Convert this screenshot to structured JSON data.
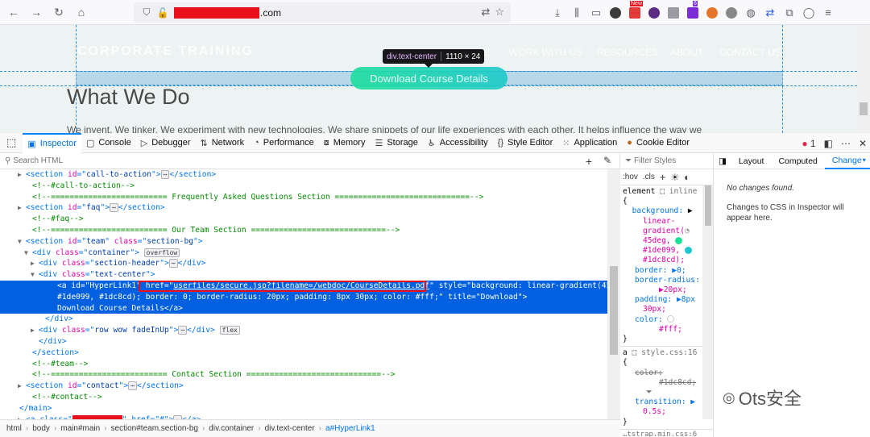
{
  "browser": {
    "url_domain": ".com",
    "toolbar_icons": [
      "back-icon",
      "forward-icon",
      "reload-icon",
      "home-icon"
    ],
    "new_badge": "New",
    "ext_badge_count": "6"
  },
  "page": {
    "brand": "CORPORATE TRAINING",
    "nav": [
      "E",
      "WORK WITH US",
      "RESOURCES",
      "ABOUT",
      "CONTACT US"
    ],
    "download_label": "Download Course Details",
    "heading": "What We Do",
    "paragraph": "We invent. We tinker. We experiment with new technologies. We share snippets of our life experiences with each other. It helps influence the way we",
    "tooltip_tag": "div.text-center",
    "tooltip_size": "1110 × 24"
  },
  "devtools": {
    "tabs": [
      {
        "label": "Inspector",
        "icon": "inspector-icon"
      },
      {
        "label": "Console",
        "icon": "console-icon"
      },
      {
        "label": "Debugger",
        "icon": "debugger-icon"
      },
      {
        "label": "Network",
        "icon": "network-icon"
      },
      {
        "label": "Performance",
        "icon": "performance-icon"
      },
      {
        "label": "Memory",
        "icon": "memory-icon"
      },
      {
        "label": "Storage",
        "icon": "storage-icon"
      },
      {
        "label": "Accessibility",
        "icon": "accessibility-icon"
      },
      {
        "label": "Style Editor",
        "icon": "style-editor-icon"
      },
      {
        "label": "Application",
        "icon": "application-icon"
      },
      {
        "label": "Cookie Editor",
        "icon": "cookie-icon"
      }
    ],
    "error_count": "1",
    "search_placeholder": "Search HTML",
    "markup_lines": [
      {
        "indent": 3,
        "tw": "▶",
        "parts": [
          [
            "tg",
            "<section "
          ],
          [
            "an",
            "id"
          ],
          [
            "tg",
            "=\""
          ],
          [
            "av",
            "call-to-action"
          ],
          [
            "tg",
            "\">"
          ],
          [
            "badge",
            "⋯"
          ],
          [
            "tg",
            "</section>"
          ]
        ]
      },
      {
        "indent": 4,
        "tw": "",
        "parts": [
          [
            "cm",
            "<!--#call-to-action-->"
          ]
        ]
      },
      {
        "indent": 4,
        "tw": "",
        "parts": [
          [
            "cm",
            "<!--========================= Frequently Asked Questions Section =============================-->"
          ]
        ]
      },
      {
        "indent": 3,
        "tw": "▶",
        "parts": [
          [
            "tg",
            "<section "
          ],
          [
            "an",
            "id"
          ],
          [
            "tg",
            "=\""
          ],
          [
            "av",
            "faq"
          ],
          [
            "tg",
            "\">"
          ],
          [
            "badge",
            "⋯"
          ],
          [
            "tg",
            "</section>"
          ]
        ]
      },
      {
        "indent": 4,
        "tw": "",
        "parts": [
          [
            "cm",
            "<!--#faq-->"
          ]
        ]
      },
      {
        "indent": 4,
        "tw": "",
        "parts": [
          [
            "cm",
            "<!--========================= Our Team Section =============================-->"
          ]
        ]
      },
      {
        "indent": 3,
        "tw": "▼",
        "parts": [
          [
            "tg",
            "<section "
          ],
          [
            "an",
            "id"
          ],
          [
            "tg",
            "=\""
          ],
          [
            "av",
            "team"
          ],
          [
            "tg",
            "\" "
          ],
          [
            "an",
            "class"
          ],
          [
            "tg",
            "=\""
          ],
          [
            "av",
            "section-bg"
          ],
          [
            "tg",
            "\">"
          ]
        ]
      },
      {
        "indent": 4,
        "tw": "▼",
        "parts": [
          [
            "tg",
            "<div "
          ],
          [
            "an",
            "class"
          ],
          [
            "tg",
            "=\""
          ],
          [
            "av",
            "container"
          ],
          [
            "tg",
            "\">"
          ],
          [
            "sp",
            " "
          ],
          [
            "badge",
            "overflow"
          ]
        ]
      },
      {
        "indent": 5,
        "tw": "▶",
        "parts": [
          [
            "tg",
            "<div "
          ],
          [
            "an",
            "class"
          ],
          [
            "tg",
            "=\""
          ],
          [
            "av",
            "section-header"
          ],
          [
            "tg",
            "\">"
          ],
          [
            "badge",
            "⋯"
          ],
          [
            "tg",
            "</div>"
          ]
        ]
      },
      {
        "indent": 5,
        "tw": "▼",
        "parts": [
          [
            "tg",
            "<div "
          ],
          [
            "an",
            "class"
          ],
          [
            "tg",
            "=\""
          ],
          [
            "av",
            "text-center"
          ],
          [
            "tg",
            "\">"
          ]
        ]
      }
    ],
    "selected_lines": [
      "<a id=\"HyperLink1\" href=\"userfiles/secure.jsp?filename=/webdoc/CourseDetails.pdf\" style=\"background: linear-gradient(45deg,",
      "#1de099, #1dc8cd); border: 0; border-radius: 20px; padding: 8px 30px; color: #fff;\" title=\"Download\">",
      "Download Course Details</a>"
    ],
    "markup_lines_after": [
      {
        "indent": 6,
        "tw": "",
        "parts": [
          [
            "tg",
            "</div>"
          ]
        ]
      },
      {
        "indent": 5,
        "tw": "▶",
        "parts": [
          [
            "tg",
            "<div "
          ],
          [
            "an",
            "class"
          ],
          [
            "tg",
            "=\""
          ],
          [
            "av",
            "row wow fadeInUp"
          ],
          [
            "tg",
            "\">"
          ],
          [
            "badge",
            "⋯"
          ],
          [
            "tg",
            "</div>"
          ],
          [
            "sp",
            " "
          ],
          [
            "badge",
            "flex"
          ]
        ]
      },
      {
        "indent": 5,
        "tw": "",
        "parts": [
          [
            "tg",
            "</div>"
          ]
        ]
      },
      {
        "indent": 4,
        "tw": "",
        "parts": [
          [
            "tg",
            "</section>"
          ]
        ]
      },
      {
        "indent": 4,
        "tw": "",
        "parts": [
          [
            "cm",
            "<!--#team-->"
          ]
        ]
      },
      {
        "indent": 4,
        "tw": "",
        "parts": [
          [
            "cm",
            "<!--========================= Contact Section =============================-->"
          ]
        ]
      },
      {
        "indent": 3,
        "tw": "▶",
        "parts": [
          [
            "tg",
            "<section "
          ],
          [
            "an",
            "id"
          ],
          [
            "tg",
            "=\""
          ],
          [
            "av",
            "contact"
          ],
          [
            "tg",
            "\">"
          ],
          [
            "badge",
            "⋯"
          ],
          [
            "tg",
            "</section>"
          ]
        ]
      },
      {
        "indent": 4,
        "tw": "",
        "parts": [
          [
            "cm",
            "<!--#contact-->"
          ]
        ]
      },
      {
        "indent": 2,
        "tw": "",
        "parts": [
          [
            "tg",
            "</main>"
          ]
        ]
      }
    ],
    "last_line_prefix": "<a class=\"",
    "last_line_suffix": "\" href=\"#\">",
    "last_line_end": "</a>",
    "breadcrumbs": [
      "html",
      "body",
      "main#main",
      "section#team.section-bg",
      "div.container",
      "div.text-center",
      "a#HyperLink1"
    ],
    "rules": {
      "filter_placeholder": "Filter Styles",
      "hov": ":hov",
      "cls": ".cls",
      "element_label": "element",
      "inline_label": "inline",
      "decl1": [
        [
          "pn",
          "background: "
        ],
        [
          "pv",
          "▶"
        ]
      ],
      "lines": [
        "element ⬚  inline",
        "{"
      ],
      "style_source": "style.css:16",
      "bootstrap_source": "…tstrap.min.css:6",
      "bg_value_1": "linear-",
      "bg_value_2": "gradient(",
      "bg_value_3": "45deg,",
      "bg_value_4": "#1de099,",
      "bg_value_5": "#1dc8cd);",
      "border": "border: ▶0;",
      "radius": "border-radius:",
      "radius_v": "▶20px;",
      "padding": "padding: ▶8px",
      "padding_v": "30px;",
      "color": "color:",
      "color_v": "#fff;",
      "close": "}",
      "a_sel": "a ⬚",
      "open": "{",
      "strike_prop": "color:",
      "strike_val": "#1dc8cd;",
      "transition": "transition: ▶",
      "transition_v": "0.5s;",
      "close2": "}",
      "color_green": "#1de099",
      "color_teal": "#1dc8cd"
    },
    "side_tabs": [
      "Layout",
      "Computed",
      "Change"
    ],
    "no_changes": "No changes found.",
    "no_changes_detail": "Changes to CSS in Inspector will appear here."
  },
  "watermark": "Ots安全"
}
